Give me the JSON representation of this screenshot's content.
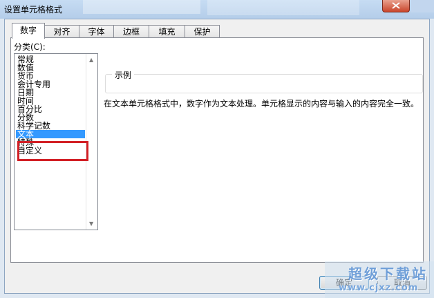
{
  "window": {
    "title": "设置单元格格式"
  },
  "tabs": [
    {
      "label": "数字",
      "active": true
    },
    {
      "label": "对齐"
    },
    {
      "label": "字体"
    },
    {
      "label": "边框"
    },
    {
      "label": "填充"
    },
    {
      "label": "保护"
    }
  ],
  "category": {
    "label": "分类(C):",
    "items": [
      "常规",
      "数值",
      "货币",
      "会计专用",
      "日期",
      "时间",
      "百分比",
      "分数",
      "科学记数",
      "文本",
      "特殊",
      "自定义"
    ],
    "selected": "文本"
  },
  "sample": {
    "label": "示例"
  },
  "description": "在文本单元格格式中，数字作为文本处理。单元格显示的内容与输入的内容完全一致。",
  "buttons": {
    "ok": "确定",
    "cancel": "取消"
  },
  "watermark": {
    "main": "超级下载站",
    "url": "www.cjxz.com"
  },
  "colors": {
    "selection": "#3399ff",
    "highlight_box": "#d21f25"
  }
}
